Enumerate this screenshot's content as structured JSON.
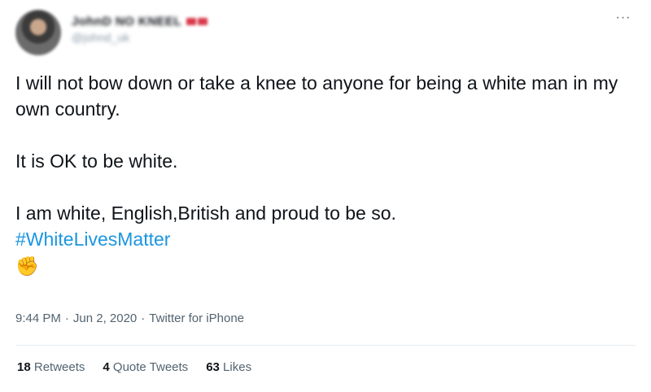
{
  "header": {
    "display_name": "JohnD NO KNEEL",
    "handle": "@johnd_uk",
    "more_label": "···"
  },
  "tweet": {
    "paragraph1": "I will not bow down or take a knee to anyone for being a white man in my own country.",
    "paragraph2": "It is OK to be white.",
    "paragraph3": "I am white, English,British and proud to be so.",
    "hashtag": "#WhiteLivesMatter",
    "emoji": "✊"
  },
  "meta": {
    "time": "9:44 PM",
    "separator": "·",
    "date": "Jun 2, 2020",
    "source": "Twitter for iPhone"
  },
  "stats": {
    "retweets_count": "18",
    "retweets_label": "Retweets",
    "quotes_count": "4",
    "quotes_label": "Quote Tweets",
    "likes_count": "63",
    "likes_label": "Likes"
  },
  "colors": {
    "link": "#1b95e0",
    "text": "#0f1419",
    "secondary": "#536471",
    "divider": "#e6ecf0"
  }
}
